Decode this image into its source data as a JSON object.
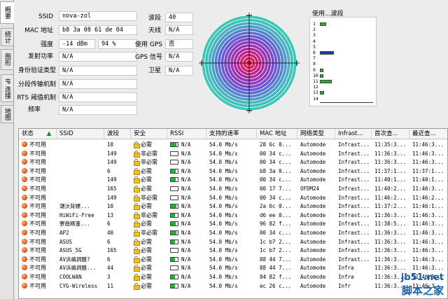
{
  "tabs": [
    "概要",
    "统计",
    "图形",
    "IP 连接",
    "地图"
  ],
  "info": {
    "ssid_label": "SSID",
    "ssid": "nova-zol",
    "mac_label": "MAC 地址",
    "mac": "b8 3a 08 61 de 04",
    "strength_label": "强度",
    "strength_dbm": "-14 dBm",
    "strength_pct": "94 %",
    "tx_label": "发射功率",
    "tx": "N/A",
    "auth_label": "身份验证类型",
    "auth": "N/A",
    "frag_label": "分段传输机制",
    "frag": "N/A",
    "rts_label": "RTS 阈值机制",
    "rts": "N/A",
    "freq_label": "频率",
    "freq": "N/A",
    "band_label": "波段",
    "band": "40",
    "antenna_label": "天线",
    "antenna": "N/A",
    "gps_label": "使用 GPS",
    "gps": "否",
    "gps_signal_label": "GPS 信号",
    "gps_signal": "N/A",
    "sat_label": "卫星",
    "sat": "N/A"
  },
  "usage": {
    "title": "使用...波段",
    "channels": [
      {
        "ch": "1",
        "value": 0.18,
        "color": "#22b030"
      },
      {
        "ch": "2",
        "value": 0,
        "color": "#22b030"
      },
      {
        "ch": "3",
        "value": 0,
        "color": "#22b030"
      },
      {
        "ch": "4",
        "value": 0,
        "color": "#22b030"
      },
      {
        "ch": "5",
        "value": 0,
        "color": "#22b030"
      },
      {
        "ch": "6",
        "value": 0.42,
        "color": "#1a3ab0"
      },
      {
        "ch": "7",
        "value": 0,
        "color": "#22b030"
      },
      {
        "ch": "8",
        "value": 0,
        "color": "#22b030"
      },
      {
        "ch": "9",
        "value": 0.1,
        "color": "#22b030"
      },
      {
        "ch": "10",
        "value": 0.1,
        "color": "#22b030"
      },
      {
        "ch": "11",
        "value": 0.35,
        "color": "#22b030"
      },
      {
        "ch": "12",
        "value": 0,
        "color": "#22b030"
      },
      {
        "ch": "13",
        "value": 0.12,
        "color": "#22b030"
      },
      {
        "ch": "14",
        "value": 0,
        "color": "#22b030"
      }
    ]
  },
  "table": {
    "headers": [
      "状态",
      "SSID",
      "波段",
      "安全",
      "RSSI",
      "支持的速率",
      "MAC 地址",
      "网络类型",
      "Infrast...",
      "首次查...",
      "最近查..."
    ],
    "rows": [
      [
        "不可用",
        "",
        "10",
        "必需",
        0.8,
        "N/A",
        "54.0 Mb/s",
        "28 6c 0...",
        "Automode",
        "Infrast...",
        "11:35:3...",
        "11:46:3..."
      ],
      [
        "不可用",
        "",
        "149",
        "非必需",
        0,
        "N/A",
        "54.0 Mb/s",
        "00 34 c...",
        "Automode",
        "Infrast...",
        "11:36:3...",
        "11:46:3..."
      ],
      [
        "不可用",
        "",
        "149",
        "非必需",
        0,
        "N/A",
        "54.0 Mb/s",
        "00 34 c...",
        "Automode",
        "Infrast...",
        "11:36:3...",
        "11:46:3..."
      ],
      [
        "不可用",
        "",
        "6",
        "必需",
        0.7,
        "N/A",
        "54.0 Mb/s",
        "b8 3a 0...",
        "Automode",
        "Infrast...",
        "11:37:1...",
        "11:37:1..."
      ],
      [
        "不可用",
        "",
        "149",
        "必需",
        0.7,
        "N/A",
        "54.0 Mb/s",
        "00 34 c...",
        "Automode",
        "Infrast...",
        "11:40:1...",
        "11:40:1..."
      ],
      [
        "不可用",
        "",
        "165",
        "必需",
        0,
        "N/A",
        "54.0 Mb/s",
        "00 17 7...",
        "OFDM24",
        "Infrast...",
        "11:40:2...",
        "11:46:3..."
      ],
      [
        "不可用",
        "",
        "149",
        "非必需",
        0,
        "N/A",
        "54.0 Mb/s",
        "00 34 c...",
        "Automode",
        "Infrast...",
        "11:46:2...",
        "11:46:2..."
      ],
      [
        "不可用",
        "潮汏背嫖...",
        "10",
        "必需",
        0.8,
        "N/A",
        "54.0 Mb/s",
        "2a 6c 0...",
        "Automode",
        "Infrast...",
        "11:37:2...",
        "11:46:1..."
      ],
      [
        "不可用",
        "HiWiFi-Free",
        "13",
        "非必需",
        0.6,
        "N/A",
        "54.0 Mb/s",
        "d6 ee 0...",
        "Automode",
        "Infrast...",
        "11:36:3...",
        "11:46:3..."
      ],
      [
        "不可用",
        "寮揩稼蓬...",
        "6",
        "必需",
        0.7,
        "N/A",
        "54.0 Mb/s",
        "96 82 f...",
        "Automode",
        "Infrast...",
        "11:38:5...",
        "11:46:3..."
      ],
      [
        "不可用",
        "AP2",
        "40",
        "非必需",
        0.8,
        "N/A",
        "54.0 Mb/s",
        "00 34 c...",
        "Automode",
        "Infrast...",
        "11:36:3...",
        "11:46:3..."
      ],
      [
        "不可用",
        "ASUS",
        "6",
        "必需",
        0.6,
        "N/A",
        "54.0 Mb/s",
        "1c b7 2...",
        "Automode",
        "Infrast...",
        "11:36:3...",
        "11:46:3..."
      ],
      [
        "不可用",
        "ASUS_5G",
        "165",
        "必需",
        0,
        "N/A",
        "54.0 Mb/s",
        "1c b7 2...",
        "Automode",
        "Infrast...",
        "11:36:3...",
        "11:46:3..."
      ],
      [
        "不可用",
        "AV浜嶋洞醋?",
        "6",
        "必需",
        0.6,
        "N/A",
        "54.0 Mb/s",
        "88 44 7...",
        "Automode",
        "Infrast...",
        "11:36:3...",
        "11:46:3..."
      ],
      [
        "不可用",
        "AV浜嶋洞醋...",
        "44",
        "必需",
        0,
        "N/A",
        "54.0 Mb/s",
        "88 44 7...",
        "Automode",
        "Infra",
        "11:36:3...",
        "11:46:3..."
      ],
      [
        "不可用",
        "COOLWAN",
        "3",
        "必需",
        0.6,
        "N/A",
        "54.0 Mb/s",
        "84 82 f...",
        "Automode",
        "Infra",
        "11:36:3...",
        "11:46:3..."
      ],
      [
        "不可用",
        "CYG-Wireless",
        "11",
        "必需",
        0.6,
        "N/A",
        "54.0 Mb/s",
        "ec 26 c...",
        "Automode",
        "Infr",
        "11:36:3...",
        "11:46:3..."
      ]
    ]
  },
  "watermark": {
    "line1": "jb51.net",
    "line2": "脚本之家"
  }
}
